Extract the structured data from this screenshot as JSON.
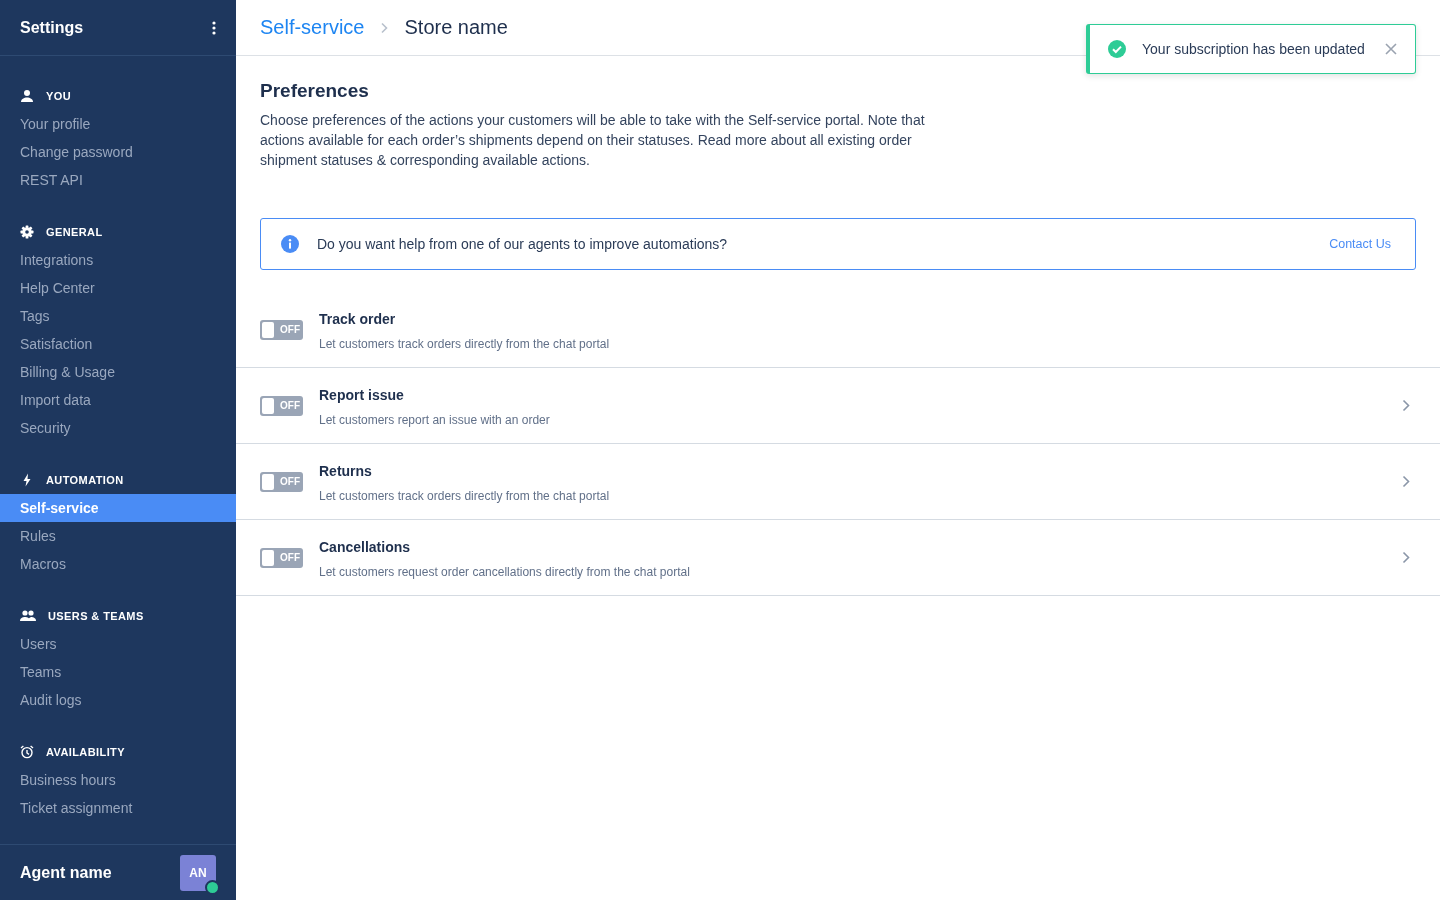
{
  "sidebar": {
    "title": "Settings",
    "sections": [
      {
        "kind": "person",
        "title": "YOU",
        "items": [
          {
            "label": "Your profile",
            "selected": false
          },
          {
            "label": "Change password",
            "selected": false
          },
          {
            "label": "REST API",
            "selected": false
          }
        ]
      },
      {
        "kind": "gear",
        "title": "GENERAL",
        "items": [
          {
            "label": "Integrations",
            "selected": false
          },
          {
            "label": "Help Center",
            "selected": false
          },
          {
            "label": "Tags",
            "selected": false
          },
          {
            "label": "Satisfaction",
            "selected": false
          },
          {
            "label": "Billing & Usage",
            "selected": false
          },
          {
            "label": "Import data",
            "selected": false
          },
          {
            "label": "Security",
            "selected": false
          }
        ]
      },
      {
        "kind": "bolt",
        "title": "AUTOMATION",
        "items": [
          {
            "label": "Self-service",
            "selected": true
          },
          {
            "label": "Rules",
            "selected": false
          },
          {
            "label": "Macros",
            "selected": false
          }
        ]
      },
      {
        "kind": "people",
        "title": "USERS & TEAMS",
        "items": [
          {
            "label": "Users",
            "selected": false
          },
          {
            "label": "Teams",
            "selected": false
          },
          {
            "label": "Audit logs",
            "selected": false
          }
        ]
      },
      {
        "kind": "alarm",
        "title": "AVAILABILITY",
        "items": [
          {
            "label": "Business hours",
            "selected": false
          },
          {
            "label": "Ticket assignment",
            "selected": false
          }
        ]
      }
    ],
    "user": {
      "name": "Agent name",
      "initials": "AN",
      "online": true
    }
  },
  "breadcrumb": {
    "parent": "Self-service",
    "current": "Store name"
  },
  "toast": {
    "message": "Your subscription has been updated"
  },
  "preferences": {
    "title": "Preferences",
    "description": "Choose preferences of the actions your customers will be able to take with the Self-service portal. Note that actions available for each order’s shipments depend on their statuses. Read more about all existing order shipment statuses & corresponding available actions."
  },
  "banner": {
    "text": "Do you want help from one of our agents to improve automations?",
    "link": "Contact Us"
  },
  "actions": [
    {
      "title": "Track order",
      "description": "Let customers track orders directly from the chat portal",
      "on": false,
      "toggle_label": "OFF",
      "has_details": false
    },
    {
      "title": "Report issue",
      "description": "Let customers report an issue with an order",
      "on": false,
      "toggle_label": "OFF",
      "has_details": true
    },
    {
      "title": "Returns",
      "description": "Let customers track orders directly from the chat portal",
      "on": false,
      "toggle_label": "OFF",
      "has_details": true
    },
    {
      "title": "Cancellations",
      "description": "Let customers request order cancellations directly from the chat portal",
      "on": false,
      "toggle_label": "OFF",
      "has_details": true
    }
  ]
}
